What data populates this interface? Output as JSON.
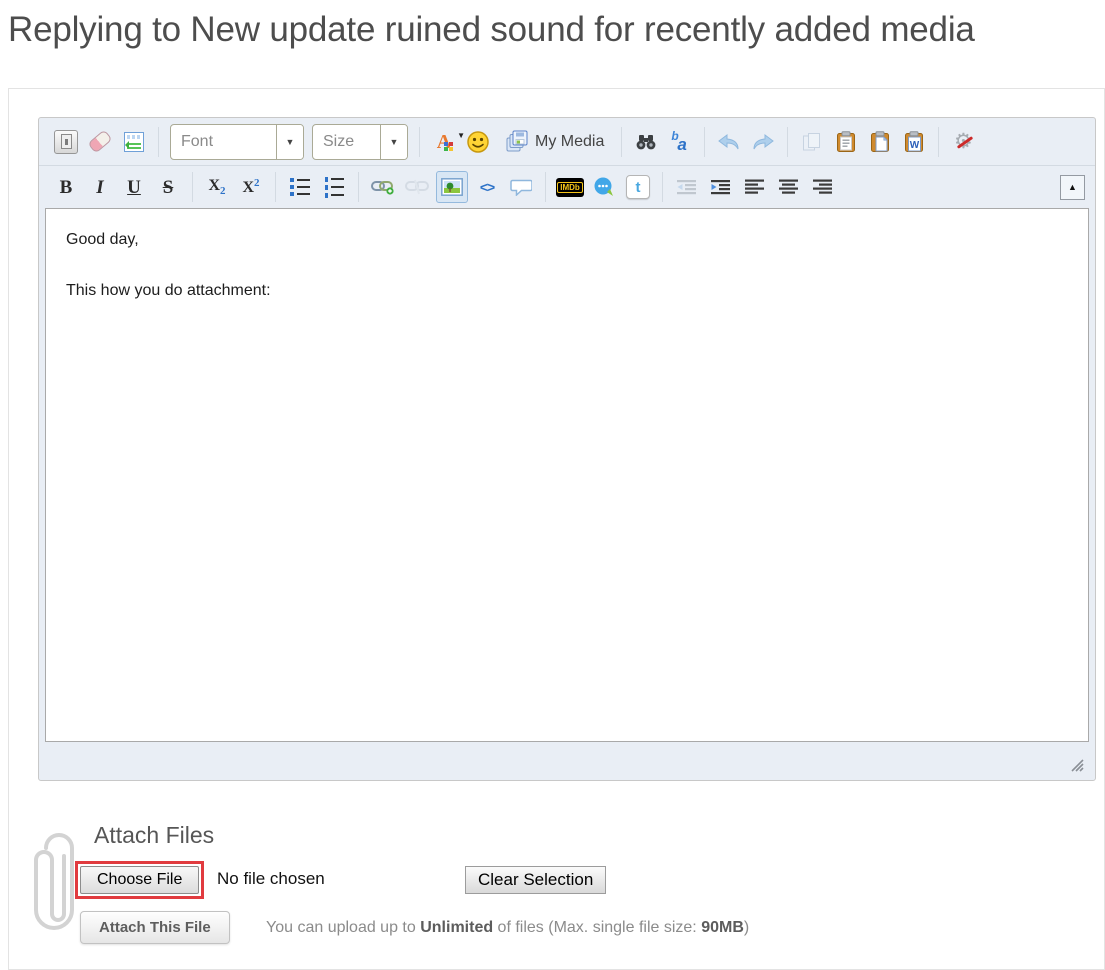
{
  "page": {
    "title": "Replying to New update ruined sound for recently added media"
  },
  "icons": {
    "dropdown_caret": "▼",
    "color_caret": "▼",
    "collapse_toolbar": "▲",
    "replace_b": "b",
    "replace_a": "a"
  },
  "editor": {
    "toolbar1": {
      "font_label": "Font",
      "size_label": "Size",
      "my_media_label": "My Media"
    },
    "toolbar2": {
      "bold": "B",
      "italic": "I",
      "underline": "U",
      "strike": "S",
      "sub_base": "X",
      "sub_digit": "2",
      "sup_base": "X",
      "sup_digit": "2",
      "code": "<>",
      "imdb": "IMDb",
      "twitter": "t"
    },
    "content": {
      "line1": "Good day,",
      "line2": "This how you do attachment:"
    }
  },
  "attach": {
    "heading": "Attach Files",
    "choose_file_label": "Choose File",
    "no_file_text": "No file chosen",
    "clear_selection_label": "Clear Selection",
    "attach_this_file_label": "Attach This File",
    "upload_info_prefix": "You can upload up to ",
    "upload_info_bold1": "Unlimited",
    "upload_info_mid": " of files (Max. single file size: ",
    "upload_info_bold2": "90MB",
    "upload_info_suffix": ")"
  },
  "colors": {
    "highlight_red": "#e13b3f",
    "toolbar_background": "#e9eef5",
    "imdb_yellow": "#f5c518",
    "link_blue": "#2d72c8"
  }
}
